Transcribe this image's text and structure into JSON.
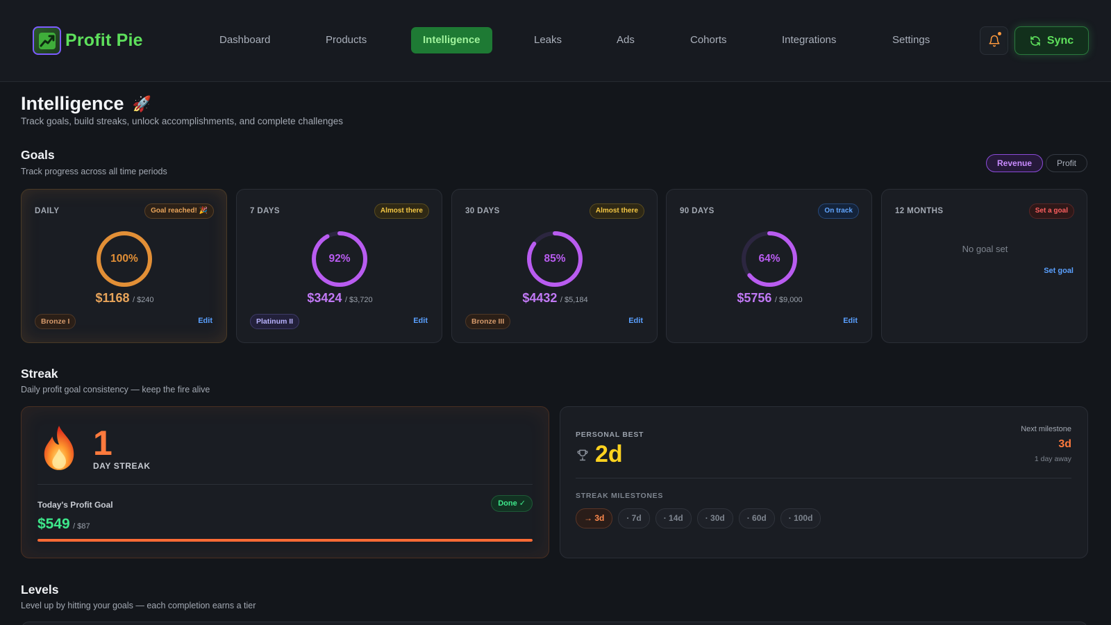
{
  "app": {
    "name": "Profit Pie"
  },
  "nav": {
    "items": [
      {
        "label": "Dashboard"
      },
      {
        "label": "Products"
      },
      {
        "label": "Intelligence"
      },
      {
        "label": "Leaks"
      },
      {
        "label": "Ads"
      },
      {
        "label": "Cohorts"
      },
      {
        "label": "Integrations"
      },
      {
        "label": "Settings"
      }
    ],
    "active_label": "Intelligence",
    "sync_label": "Sync"
  },
  "page": {
    "title": "Intelligence",
    "title_emoji": "🚀",
    "subtitle": "Track goals, build streaks, unlock accomplishments, and complete challenges"
  },
  "goals": {
    "title": "Goals",
    "subtitle": "Track progress across all time periods",
    "toggle": {
      "revenue": "Revenue",
      "profit": "Profit",
      "selected": "Revenue"
    },
    "cards": [
      {
        "period": "DAILY",
        "badge": "Goal reached! 🎉",
        "badge_style": "orange",
        "percent_label": "100%",
        "percent": 100,
        "ring_color": "#e28f36",
        "amount": "$1168",
        "target": "/ $240",
        "amount_color": "#e8a45a",
        "tier": "Bronze I",
        "tier_style": "bronze",
        "edit": "Edit"
      },
      {
        "period": "7 DAYS",
        "badge": "Almost there",
        "badge_style": "yellow",
        "percent_label": "92%",
        "percent": 92,
        "ring_color": "#b95cf0",
        "amount": "$3424",
        "target": "/ $3,720",
        "amount_color": "#c179f5",
        "tier": "Platinum II",
        "tier_style": "plat",
        "edit": "Edit"
      },
      {
        "period": "30 DAYS",
        "badge": "Almost there",
        "badge_style": "yellow",
        "percent_label": "85%",
        "percent": 85,
        "ring_color": "#b95cf0",
        "amount": "$4432",
        "target": "/ $5,184",
        "amount_color": "#c179f5",
        "tier": "Bronze III",
        "tier_style": "bronze",
        "edit": "Edit"
      },
      {
        "period": "90 DAYS",
        "badge": "On track",
        "badge_style": "blue",
        "percent_label": "64%",
        "percent": 64,
        "ring_color": "#b95cf0",
        "amount": "$5756",
        "target": "/ $9,000",
        "amount_color": "#c179f5",
        "tier": "",
        "tier_style": "",
        "edit": "Edit"
      },
      {
        "period": "12 MONTHS",
        "badge": "Set a goal",
        "badge_style": "red",
        "empty_text": "No goal set",
        "set_goal": "Set goal"
      }
    ]
  },
  "streak": {
    "title": "Streak",
    "subtitle": "Daily profit goal consistency — keep the fire alive",
    "count": "1",
    "count_label": "DAY STREAK",
    "today_label": "Today's Profit Goal",
    "done_badge": "Done ✓",
    "today_amount": "$549",
    "today_target": "/ $87",
    "progress": 1.0,
    "personal_best_label": "PERSONAL BEST",
    "personal_best_value": "2d",
    "next_milestone_label": "Next milestone",
    "next_milestone_value": "3d",
    "next_milestone_away": "1 day away",
    "milestones_label": "STREAK MILESTONES",
    "milestones": [
      "→ 3d",
      "· 7d",
      "· 14d",
      "· 30d",
      "· 60d",
      "· 100d"
    ]
  },
  "levels": {
    "title": "Levels",
    "subtitle": "Level up by hitting your goals — each completion earns a tier"
  }
}
